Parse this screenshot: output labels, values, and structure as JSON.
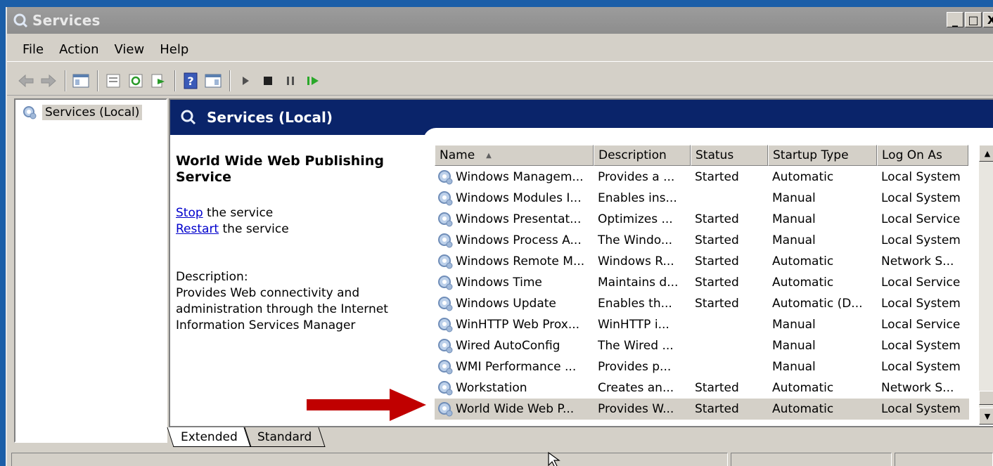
{
  "window": {
    "title": "Services"
  },
  "titlebar_buttons": [
    "_",
    "□",
    "X"
  ],
  "menu": [
    "File",
    "Action",
    "View",
    "Help"
  ],
  "tree": {
    "root_label": "Services (Local)"
  },
  "banner": {
    "title": "Services (Local)"
  },
  "details": {
    "service_name": "World Wide Web Publishing Service",
    "stop_link": "Stop",
    "stop_rest": " the service",
    "restart_link": "Restart",
    "restart_rest": " the service",
    "description_label": "Description:",
    "description_lines": [
      "Provides Web connectivity and",
      "administration through the Internet",
      "Information Services Manager"
    ]
  },
  "list": {
    "columns": [
      "Name",
      "Description",
      "Status",
      "Startup Type",
      "Log On As"
    ],
    "sort_indicator": "▲",
    "rows": [
      [
        "Windows Managem...",
        "Provides a ...",
        "Started",
        "Automatic",
        "Local System"
      ],
      [
        "Windows Modules I...",
        "Enables ins...",
        "",
        "Manual",
        "Local System"
      ],
      [
        "Windows Presentat...",
        "Optimizes ...",
        "Started",
        "Manual",
        "Local Service"
      ],
      [
        "Windows Process A...",
        "The Windo...",
        "Started",
        "Manual",
        "Local System"
      ],
      [
        "Windows Remote M...",
        "Windows R...",
        "Started",
        "Automatic",
        "Network S..."
      ],
      [
        "Windows Time",
        "Maintains d...",
        "Started",
        "Automatic",
        "Local Service"
      ],
      [
        "Windows Update",
        "Enables th...",
        "Started",
        "Automatic (D...",
        "Local System"
      ],
      [
        "WinHTTP Web Prox...",
        "WinHTTP i...",
        "",
        "Manual",
        "Local Service"
      ],
      [
        "Wired AutoConfig",
        "The Wired ...",
        "",
        "Manual",
        "Local System"
      ],
      [
        "WMI Performance ...",
        "Provides p...",
        "",
        "Manual",
        "Local System"
      ],
      [
        "Workstation",
        "Creates an...",
        "Started",
        "Automatic",
        "Network S..."
      ],
      [
        "World Wide Web P...",
        "Provides W...",
        "Started",
        "Automatic",
        "Local System"
      ]
    ],
    "selected_row": 11
  },
  "tabs": [
    "Extended",
    "Standard"
  ],
  "colors": {
    "banner": "#0a246a",
    "arrow": "#c00000",
    "desktop": "#1b5ea8"
  },
  "icons": {
    "service": "service-gear-icon",
    "back": "back-arrow-icon",
    "forward": "forward-arrow-icon",
    "play": "play-icon",
    "stop": "stop-icon",
    "pause": "pause-icon",
    "restart": "restart-icon"
  }
}
